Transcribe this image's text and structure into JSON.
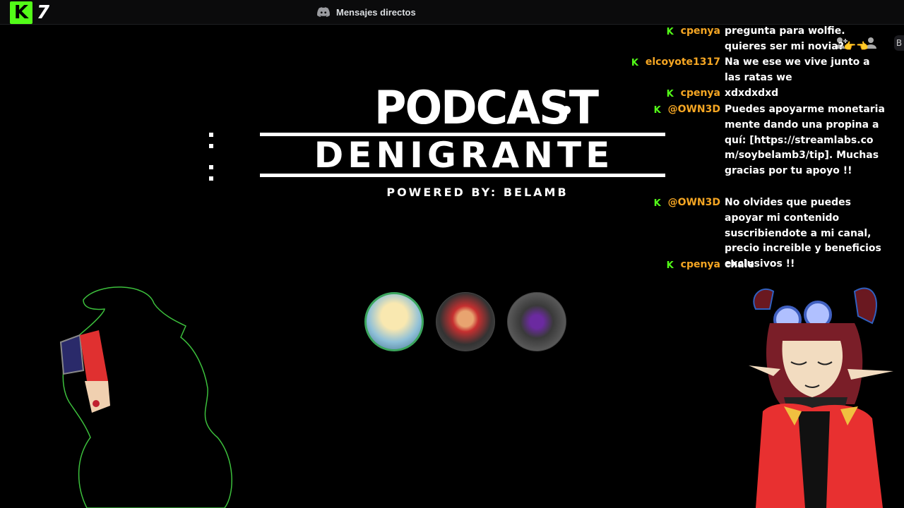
{
  "topbar": {
    "kick_letter": "K",
    "viewer_count": "7",
    "discord_label": "Mensajes directos"
  },
  "logo": {
    "line1": "PODCAST",
    "line2": "DENIGRANTE",
    "line3": "POWERED BY: BELAMB"
  },
  "chat": {
    "side_button": "B",
    "messages": [
      {
        "user": "cpenya",
        "text": "pregunta para wolfie. quieres ser mi novia?👉👈"
      },
      {
        "user": "elcoyote1317",
        "text": "Na we ese we vive junto a las ratas we"
      },
      {
        "user": "cpenya",
        "text": "xdxdxdxd"
      },
      {
        "user": "@OWN3D",
        "text": "Puedes apoyarme monetariamente dando una propina aquí: [https://streamlabs.com/soybelamb3/tip]. Muchas gracias por tu apoyo !!"
      },
      {
        "user": "@OWN3D",
        "text": "No olvides que puedes apoyar mi contenido suscribiendote a mi canal, precio increible y beneficios exclusivos !!"
      },
      {
        "user": "cpenya",
        "text": "chale"
      }
    ]
  },
  "colors": {
    "kick_green": "#53fc18",
    "username": "#f5a623",
    "speaking_ring": "#3ba55d"
  }
}
